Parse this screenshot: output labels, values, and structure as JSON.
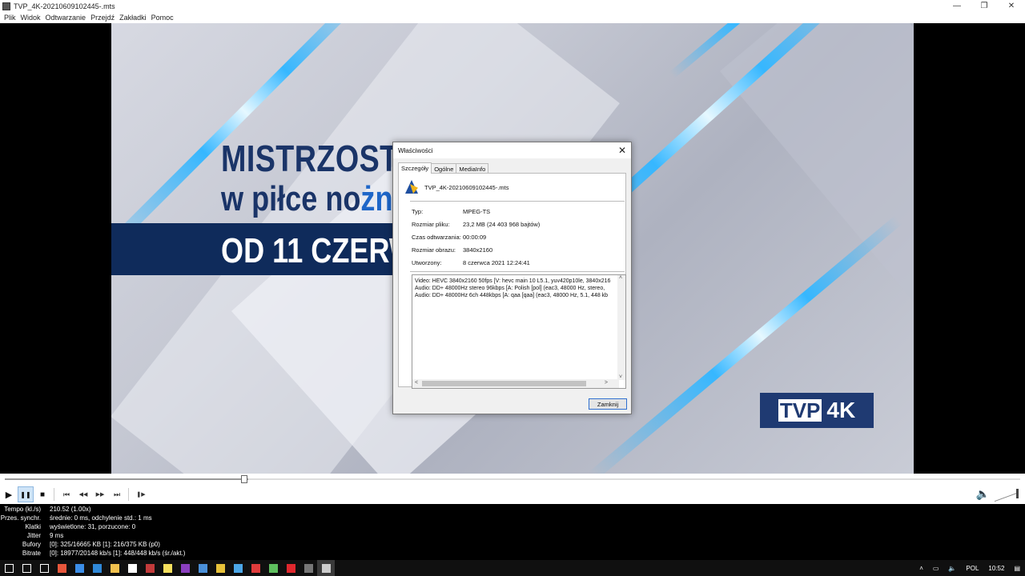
{
  "window": {
    "title": "TVP_4K-20210609102445-.mts",
    "minimize": "—",
    "maximize": "❐",
    "close": "✕"
  },
  "menu": [
    "Plik",
    "Widok",
    "Odtwarzanie",
    "Przejdź",
    "Zakładki",
    "Pomoc"
  ],
  "video_frame": {
    "headline1": "MISTRZOST",
    "headline2_plain": "w piłce no",
    "headline2_accent": "żn",
    "headline3": "OD 11 CZERW",
    "logo_tvp": "TVP",
    "logo_4k": "4K"
  },
  "dialog": {
    "title": "Właściwości",
    "close": "✕",
    "tabs": [
      "Szczegóły",
      "Ogólne",
      "MediaInfo"
    ],
    "active_tab": "Szczegóły",
    "file_name": "TVP_4K-20210609102445-.mts",
    "properties": [
      {
        "key": "Typ:",
        "value": "MPEG-TS"
      },
      {
        "key": "Rozmiar pliku:",
        "value": "23,2 MB (24 403 968 bajtów)"
      },
      {
        "key": "Czas odtwarzania:",
        "value": "00:00:09"
      },
      {
        "key": "Rozmiar obrazu:",
        "value": "3840x2160"
      },
      {
        "key": "Utworzony:",
        "value": "8 czerwca 2021 12:24:41"
      }
    ],
    "streams": [
      "Video: HEVC 3840x2160 50fps [V: hevc main 10 L5.1, yuv420p10le, 3840x216",
      "Audio: DD+ 48000Hz stereo 96kbps [A: Polish [pol] (eac3, 48000 Hz, stereo,",
      "Audio: DD+ 48000Hz 6ch 448kbps [A: qaa [qaa] (eac3, 48000 Hz, 5.1, 448 kb"
    ],
    "close_button": "Zamknij"
  },
  "player": {
    "seek_fraction": 0.24,
    "buttons": {
      "play": "▶",
      "pause": "❚❚",
      "stop": "■",
      "prev": "⏮",
      "rewind": "◀◀",
      "forward": "▶▶",
      "next": "⏭",
      "frame_step": "❚▶"
    },
    "volume_icon": "🔈"
  },
  "stats": [
    {
      "key": "Tempo (kl./s)",
      "value": "210.52 (1.00x)"
    },
    {
      "key": "Przes. synchr.",
      "value": "średnie: 0 ms, odchylenie std.: 1 ms"
    },
    {
      "key": "Klatki",
      "value": "wyświetlone: 31, porzucone: 0"
    },
    {
      "key": "Jitter",
      "value": "9 ms"
    },
    {
      "key": "Bufory",
      "value": "[0]: 325/16665 KB [1]: 216/375 KB (p0)"
    },
    {
      "key": "Bitrate",
      "value": "[0]: 18977/20148 kb/s [1]: 448/448 kb/s (śr./akt.)"
    }
  ],
  "taskbar": {
    "icons": [
      "start-icon",
      "search-icon",
      "task-view-icon",
      "app-icon-1",
      "app-icon-2",
      "edge-icon",
      "explorer-icon",
      "store-icon",
      "app-icon-3",
      "notes-icon",
      "app-icon-4",
      "app-icon-5",
      "chrome-icon",
      "app-icon-6",
      "app-icon-7",
      "app-icon-8",
      "opera-icon",
      "app-icon-9",
      "mpc-icon"
    ],
    "colors": [
      "#ffffff",
      "#ffffff",
      "#ffffff",
      "#e8573c",
      "#3c8ee8",
      "#2f88d8",
      "#f2c14e",
      "#ffffff",
      "#c33b3b",
      "#f6e05e",
      "#8b3fbf",
      "#4a90d9",
      "#e8c23a",
      "#4ca7e8",
      "#e03c3c",
      "#5fbf5f",
      "#e0282e",
      "#777777",
      "#cccccc"
    ],
    "language": "POL",
    "time": "10:52"
  }
}
